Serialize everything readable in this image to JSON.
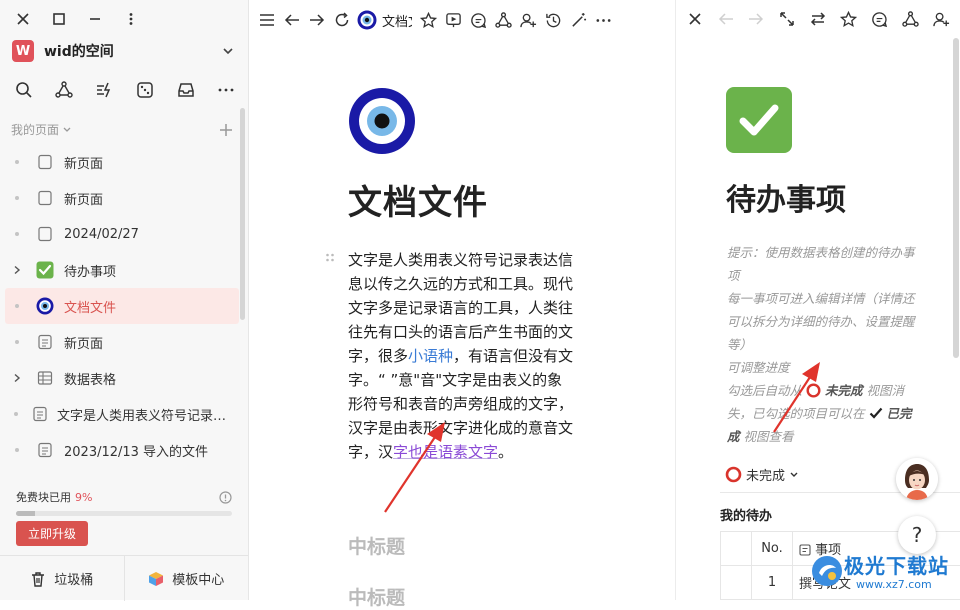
{
  "sidebar": {
    "space_avatar": "W",
    "space_name": "wid的空间",
    "section_label": "我的页面",
    "pages": [
      {
        "label": "新页面",
        "icon": "blank-page-icon",
        "expand": false,
        "active": false
      },
      {
        "label": "新页面",
        "icon": "blank-page-icon",
        "expand": false,
        "active": false
      },
      {
        "label": "2024/02/27",
        "icon": "blank-page-icon",
        "expand": false,
        "active": false
      },
      {
        "label": "待办事项",
        "icon": "checkmark-icon",
        "expand": true,
        "active": false
      },
      {
        "label": "文档文件",
        "icon": "evil-eye-icon",
        "expand": false,
        "active": true
      },
      {
        "label": "新页面",
        "icon": "doc-lines-icon",
        "expand": false,
        "active": false
      },
      {
        "label": "数据表格",
        "icon": "table-icon",
        "expand": true,
        "active": false
      },
      {
        "label": "文字是人类用表义符号记录表达信息以传之久远的方式和工具",
        "icon": "doc-lines-icon",
        "expand": false,
        "active": false
      },
      {
        "label": "2023/12/13 导入的文件",
        "icon": "doc-lines-icon",
        "expand": false,
        "active": false
      }
    ],
    "quota_label": "免费块已用",
    "quota_percent": "9%",
    "quota_fraction": 0.09,
    "upgrade_label": "立即升级",
    "trash_label": "垃圾桶",
    "templates_label": "模板中心"
  },
  "main": {
    "tab_title": "文档文件",
    "title": "文档文件",
    "paragraph": {
      "p1": "文字是人类用表义符号记录表达信息以传之久远的方式和工具。现代文字多是记录语言的工具，人类往往先有口头的语言后产生书面的文字，很多",
      "link1": "小语种",
      "p2": "，有语言但没有文字。“ ”意\"音\"文字是由表义的象形符号和表音的声旁组成的文字，汉字是由表形文字进化成的意音文字，汉",
      "purple": "字也是语素文字",
      "p3": "。"
    },
    "heading_a": "中标题",
    "heading_b": "中标题"
  },
  "right": {
    "title": "待办事项",
    "tip_lines": {
      "l1": "提示：使用数据表格创建的待办事项",
      "l2": "每一事项可进入编辑详情（详情还可以拆分为详细的待办、设置提醒等）",
      "l3": "可调整进度",
      "l4a": "勾选后自动从",
      "l4b": "未完成",
      "l4c": "视图消失，已勾选的项目可以在",
      "l4d": "已完成",
      "l4e": "视图查看"
    },
    "status_label": "未完成",
    "section_title": "我的待办",
    "table": {
      "col_no": "No.",
      "col_item": "事项",
      "rows": [
        {
          "no": "1",
          "item": "撰写论文"
        }
      ]
    },
    "help_label": "?"
  },
  "watermark": {
    "line1": "极光下载站",
    "line2": "www.xz7.com"
  },
  "colors": {
    "accent": "#d9534f",
    "link": "#3a7bd5",
    "purple": "#8a4ad6",
    "check_green": "#6bb34b"
  }
}
